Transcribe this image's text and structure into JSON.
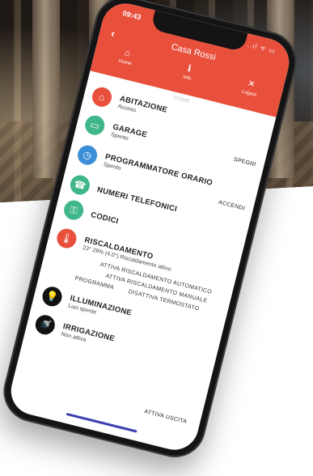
{
  "status": {
    "time": "09:43",
    "icons": "..ıl ᯤ ▭"
  },
  "header": {
    "title": "Casa Rossi",
    "back_icon": "‹",
    "nav": [
      {
        "label": "Home",
        "icon": "⌂"
      },
      {
        "label": "Info",
        "icon": "ℹ"
      },
      {
        "label": "Logout",
        "icon": "✕"
      }
    ],
    "color": "#e8503c"
  },
  "content": {
    "section_label": "HOME",
    "items": [
      {
        "title": "ABITAZIONE",
        "subtitle": "Acceso",
        "action": "",
        "color": "#e8503c",
        "icon": "⌂"
      },
      {
        "title": "GARAGE",
        "subtitle": "Spento",
        "action": "SPEGNI",
        "color": "#3fb78a",
        "icon": "▭"
      },
      {
        "title": "PROGRAMMATORE ORARIO",
        "subtitle": "Spento",
        "action": "ACCENDI",
        "color": "#3a8fd6",
        "icon": "◷"
      },
      {
        "title": "NUMERI TELEFONICI",
        "subtitle": "",
        "action": "",
        "color": "#3fb78a",
        "icon": "☎"
      },
      {
        "title": "CODICI",
        "subtitle": "",
        "action": "",
        "color": "#3fb78a",
        "icon": "⚿"
      },
      {
        "title": "RISCALDAMENTO",
        "subtitle": "23° 29% (4.0°) Riscaldamento attivo",
        "action": "",
        "color": "#e8503c",
        "icon": "🌡"
      }
    ],
    "heating_actions": [
      "ATTIVA RISCALDAMENTO AUTOMATICO",
      "ATTIVA RISCALDAMENTO MANUALE",
      "PROGRAMMA",
      "DISATTIVA TERMOSTATO"
    ],
    "lighting": {
      "title": "ILLUMINAZIONE",
      "subtitle": "Luci spente",
      "icon": "💡"
    },
    "irrigation": {
      "title": "IRRIGAZIONE",
      "subtitle": "Non attiva",
      "icon": "🚿"
    },
    "bottom_action": "ATTIVA USCITA"
  }
}
